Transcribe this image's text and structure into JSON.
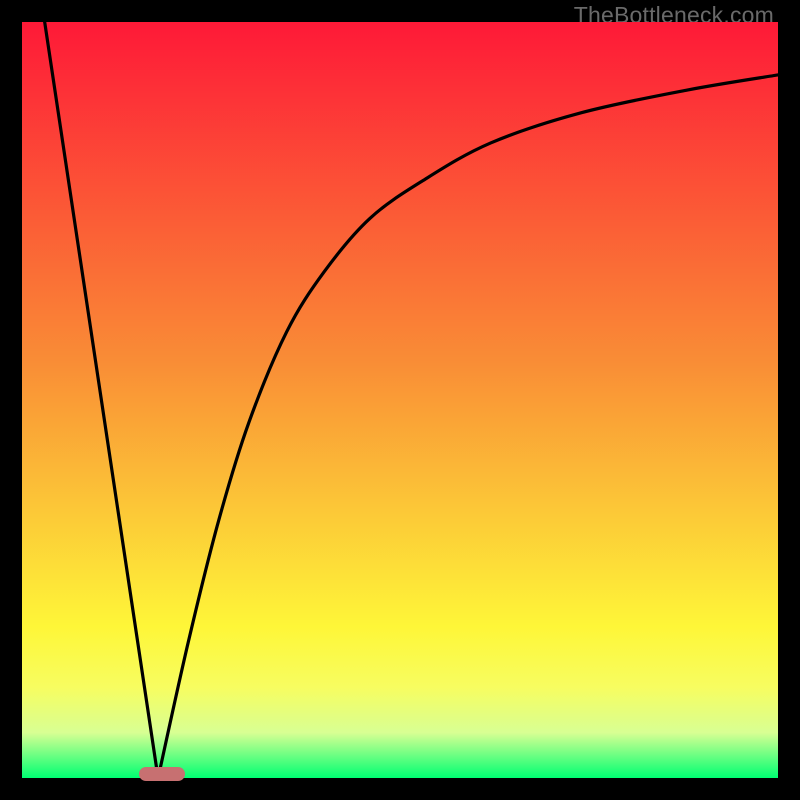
{
  "watermark": "TheBottleneck.com",
  "colors": {
    "gradient_top": "#fe1937",
    "gradient_mid1": "#f98d36",
    "gradient_mid2": "#fef638",
    "gradient_band1": "#f7fd60",
    "gradient_band2": "#d8ff93",
    "gradient_bottom": "#00ff72",
    "frame": "#000000",
    "curve": "#000000",
    "marker": "#c77071"
  },
  "chart_data": {
    "type": "line",
    "title": "",
    "xlabel": "",
    "ylabel": "",
    "xlim": [
      0,
      100
    ],
    "ylim": [
      0,
      100
    ],
    "grid": false,
    "series": [
      {
        "name": "left-segment",
        "comment": "Steep straight descent from top-left edge down to the minimum near x≈18",
        "x": [
          3,
          18
        ],
        "y": [
          100,
          0
        ]
      },
      {
        "name": "right-segment",
        "comment": "Curve rising from the minimum, steep then flattening toward upper-right",
        "x": [
          18,
          22,
          26,
          30,
          35,
          40,
          46,
          53,
          62,
          74,
          88,
          100
        ],
        "y": [
          0,
          18,
          34,
          47,
          59,
          67,
          74,
          79,
          84,
          88,
          91,
          93
        ]
      }
    ],
    "marker": {
      "comment": "Rounded pill at the dip on the baseline",
      "x_center": 18.5,
      "width_x_units": 6,
      "y": 0
    },
    "background_gradient_stops": [
      {
        "pos": 0.0,
        "color": "#fe1937"
      },
      {
        "pos": 0.45,
        "color": "#f98d36"
      },
      {
        "pos": 0.8,
        "color": "#fef638"
      },
      {
        "pos": 0.88,
        "color": "#f7fd60"
      },
      {
        "pos": 0.94,
        "color": "#d8ff93"
      },
      {
        "pos": 1.0,
        "color": "#00ff72"
      }
    ]
  }
}
